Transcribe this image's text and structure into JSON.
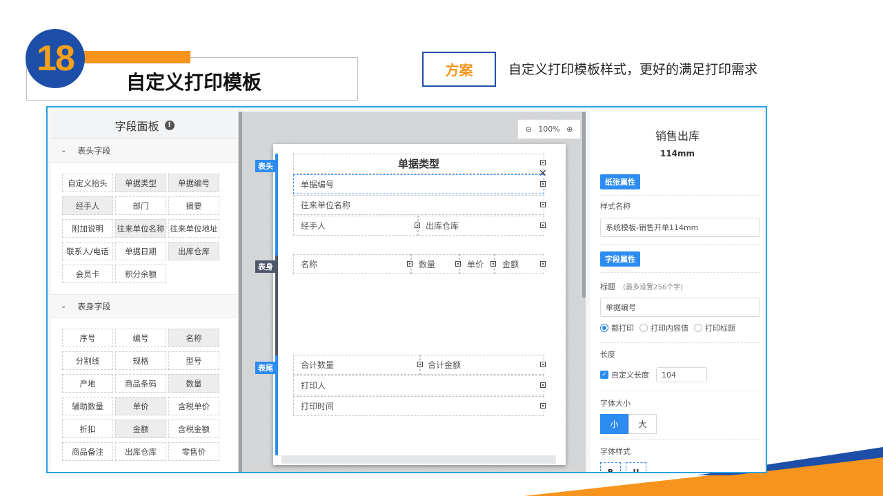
{
  "slide": {
    "number": "18",
    "title": "自定义打印模板",
    "plan_label": "方案",
    "plan_desc": "自定义打印模板样式，更好的满足打印需求"
  },
  "colors": {
    "accent_blue": "#2d8cf0",
    "frame_blue": "#29a3df",
    "dark_navy": "#1e4fa8",
    "orange": "#f7941d"
  },
  "left_panel": {
    "title": "字段面板",
    "info_icon": "info-icon",
    "header_section": {
      "label": "表头字段",
      "items": [
        {
          "label": "自定义抬头",
          "on": false
        },
        {
          "label": "单据类型",
          "on": true
        },
        {
          "label": "单据编号",
          "on": true
        },
        {
          "label": "经手人",
          "on": true
        },
        {
          "label": "部门",
          "on": false
        },
        {
          "label": "摘要",
          "on": false
        },
        {
          "label": "附加说明",
          "on": false
        },
        {
          "label": "往来单位名称",
          "on": true
        },
        {
          "label": "往来单位地址",
          "on": false
        },
        {
          "label": "联系人/电话",
          "on": false
        },
        {
          "label": "单据日期",
          "on": false
        },
        {
          "label": "出库仓库",
          "on": true
        },
        {
          "label": "会员卡",
          "on": false
        },
        {
          "label": "积分余额",
          "on": false
        }
      ]
    },
    "body_section": {
      "label": "表身字段",
      "items": [
        {
          "label": "序号",
          "on": false
        },
        {
          "label": "编号",
          "on": false
        },
        {
          "label": "名称",
          "on": true
        },
        {
          "label": "分割线",
          "on": false
        },
        {
          "label": "规格",
          "on": false
        },
        {
          "label": "型号",
          "on": false
        },
        {
          "label": "产地",
          "on": false
        },
        {
          "label": "商品条码",
          "on": false
        },
        {
          "label": "数量",
          "on": true
        },
        {
          "label": "辅助数量",
          "on": false
        },
        {
          "label": "单价",
          "on": true
        },
        {
          "label": "含税单价",
          "on": false
        },
        {
          "label": "折扣",
          "on": false
        },
        {
          "label": "金额",
          "on": true
        },
        {
          "label": "含税金额",
          "on": false
        },
        {
          "label": "商品备注",
          "on": false
        },
        {
          "label": "出库仓库",
          "on": false
        },
        {
          "label": "零售价",
          "on": false
        }
      ]
    }
  },
  "canvas": {
    "zoom": "100%",
    "tags": {
      "header": "表头",
      "body": "表身",
      "footer": "表尾"
    },
    "doc_title": "单据类型",
    "fields": {
      "doc_no": "单据编号",
      "partner": "往来单位名称",
      "handler": "经手人",
      "warehouse": "出库仓库",
      "name": "名称",
      "qty": "数量",
      "price": "单价",
      "amount": "金额",
      "total_qty": "合计数量",
      "total_amount": "合计金额",
      "printer": "打印人",
      "print_time": "打印时间"
    }
  },
  "right_panel": {
    "title": "销售出库",
    "subtitle": "114mm",
    "paper_badge": "纸张属性",
    "style_name_label": "样式名称",
    "style_name_value": "系统模板-销售开单114mm",
    "field_badge": "字段属性",
    "caption_label": "标题",
    "caption_hint": "(最多设置256个字)",
    "caption_value": "单据编号",
    "print_options": [
      "都打印",
      "打印内容值",
      "打印标题"
    ],
    "length_label": "长度",
    "custom_length_label": "自定义长度",
    "custom_length_value": "104",
    "font_size_label": "字体大小",
    "font_size_small": "小",
    "font_size_large": "大",
    "font_style_label": "字体样式",
    "bold": "B",
    "underline": "U"
  }
}
